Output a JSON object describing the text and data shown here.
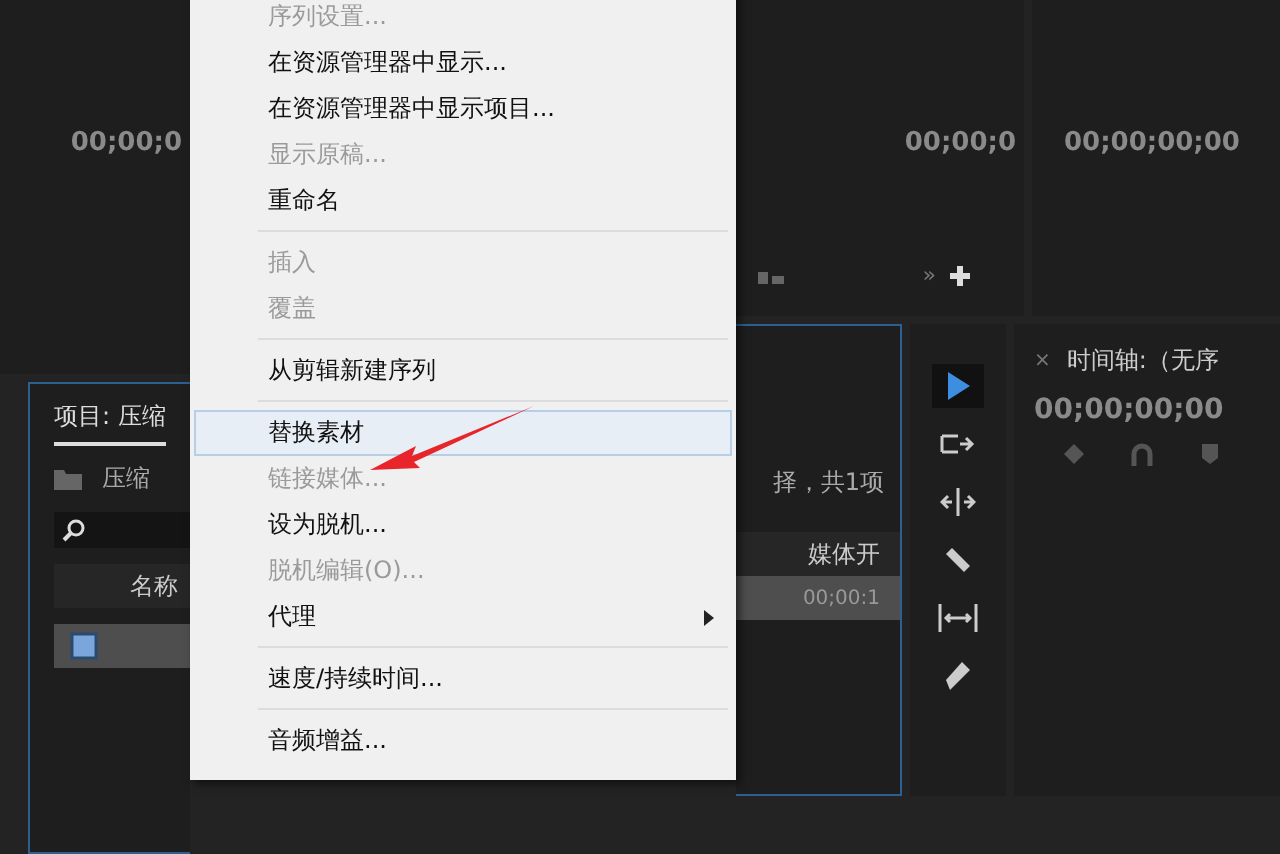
{
  "source_monitor": {
    "timecode": "00;00;0"
  },
  "program_monitor_left": {
    "timecode": "00;00;0",
    "overflow_glyph": "»"
  },
  "program_monitor_right": {
    "timecode": "00;00;00;00"
  },
  "project_panel": {
    "title": "项目: 压缩",
    "bin": "压缩",
    "status": "择，共1项",
    "columns": [
      "名称",
      "媒体开"
    ],
    "rows": [
      {
        "cell": "00;00:1",
        "selected": true
      }
    ]
  },
  "tools": [
    {
      "kind": "select",
      "selected": true
    },
    {
      "kind": "track",
      "selected": false
    },
    {
      "kind": "ripple",
      "selected": false
    },
    {
      "kind": "razor",
      "selected": false
    },
    {
      "kind": "slip",
      "selected": false
    },
    {
      "kind": "pen",
      "selected": false
    }
  ],
  "timeline": {
    "close": "×",
    "title": "时间轴:（无序",
    "timecode": "00;00;00;00"
  },
  "context_menu": {
    "items": [
      {
        "kind": "item",
        "label": "序列设置...",
        "disabled": true,
        "selected": false
      },
      {
        "kind": "item",
        "label": "在资源管理器中显示...",
        "disabled": false,
        "selected": false
      },
      {
        "kind": "item",
        "label": "在资源管理器中显示项目...",
        "disabled": false,
        "selected": false
      },
      {
        "kind": "item",
        "label": "显示原稿...",
        "disabled": true,
        "selected": false
      },
      {
        "kind": "item",
        "label": "重命名",
        "disabled": false,
        "selected": false
      },
      {
        "kind": "separator"
      },
      {
        "kind": "item",
        "label": "插入",
        "disabled": true,
        "selected": false
      },
      {
        "kind": "item",
        "label": "覆盖",
        "disabled": true,
        "selected": false
      },
      {
        "kind": "separator"
      },
      {
        "kind": "item",
        "label": "从剪辑新建序列",
        "disabled": false,
        "selected": false
      },
      {
        "kind": "separator"
      },
      {
        "kind": "item",
        "label": "替换素材",
        "disabled": false,
        "selected": true
      },
      {
        "kind": "item",
        "label": "链接媒体...",
        "disabled": true,
        "selected": false
      },
      {
        "kind": "item",
        "label": "设为脱机...",
        "disabled": false,
        "selected": false
      },
      {
        "kind": "item",
        "label": "脱机编辑(O)...",
        "disabled": true,
        "selected": false
      },
      {
        "kind": "submenu",
        "label": "代理",
        "disabled": false,
        "selected": false
      },
      {
        "kind": "separator"
      },
      {
        "kind": "item",
        "label": "速度/持续时间...",
        "disabled": false,
        "selected": false
      },
      {
        "kind": "separator"
      },
      {
        "kind": "item",
        "label": "音频增益...",
        "disabled": false,
        "selected": false
      }
    ]
  }
}
